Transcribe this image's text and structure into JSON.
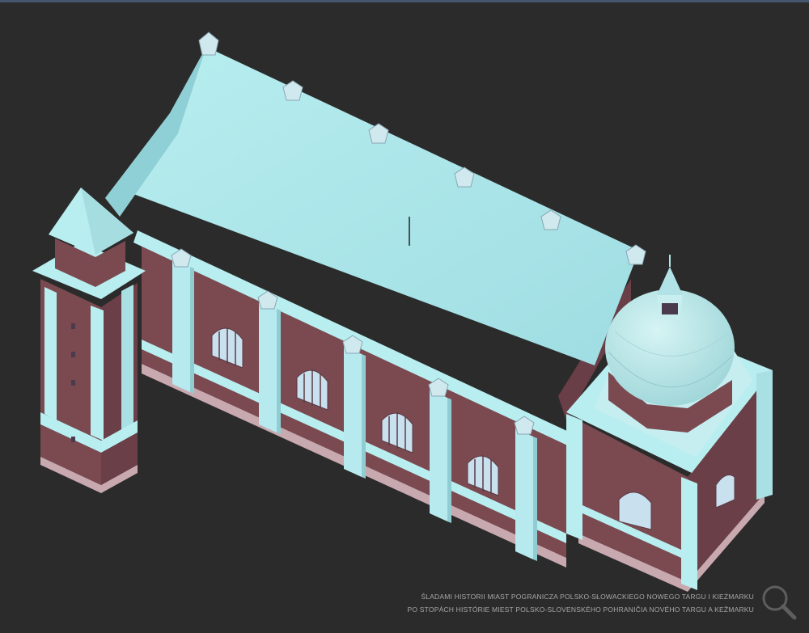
{
  "scene": {
    "subject": "3D model of a brick synagogue with a domed corner tower and a tall square tower",
    "colors": {
      "background": "#2b2b2b",
      "roof": "#a9e4e7",
      "brick": "#7a4a50",
      "trim": "#b9eef0",
      "window": "#c9e0ee"
    }
  },
  "caption": {
    "line1": "ŚLADAMI HISTORII MIAST POGRANICZA POLSKO-SŁOWACKIEGO NOWEGO TARGU I KIEŻMARKU",
    "line2": "PO STOPÁCH HISTÓRIE MIEST POLSKO-SLOVENSKÉHO POHRANIČIA NOVÉHO TARGU A KEŽMARKU"
  },
  "controls": {
    "zoom_icon": "magnifier-icon"
  }
}
